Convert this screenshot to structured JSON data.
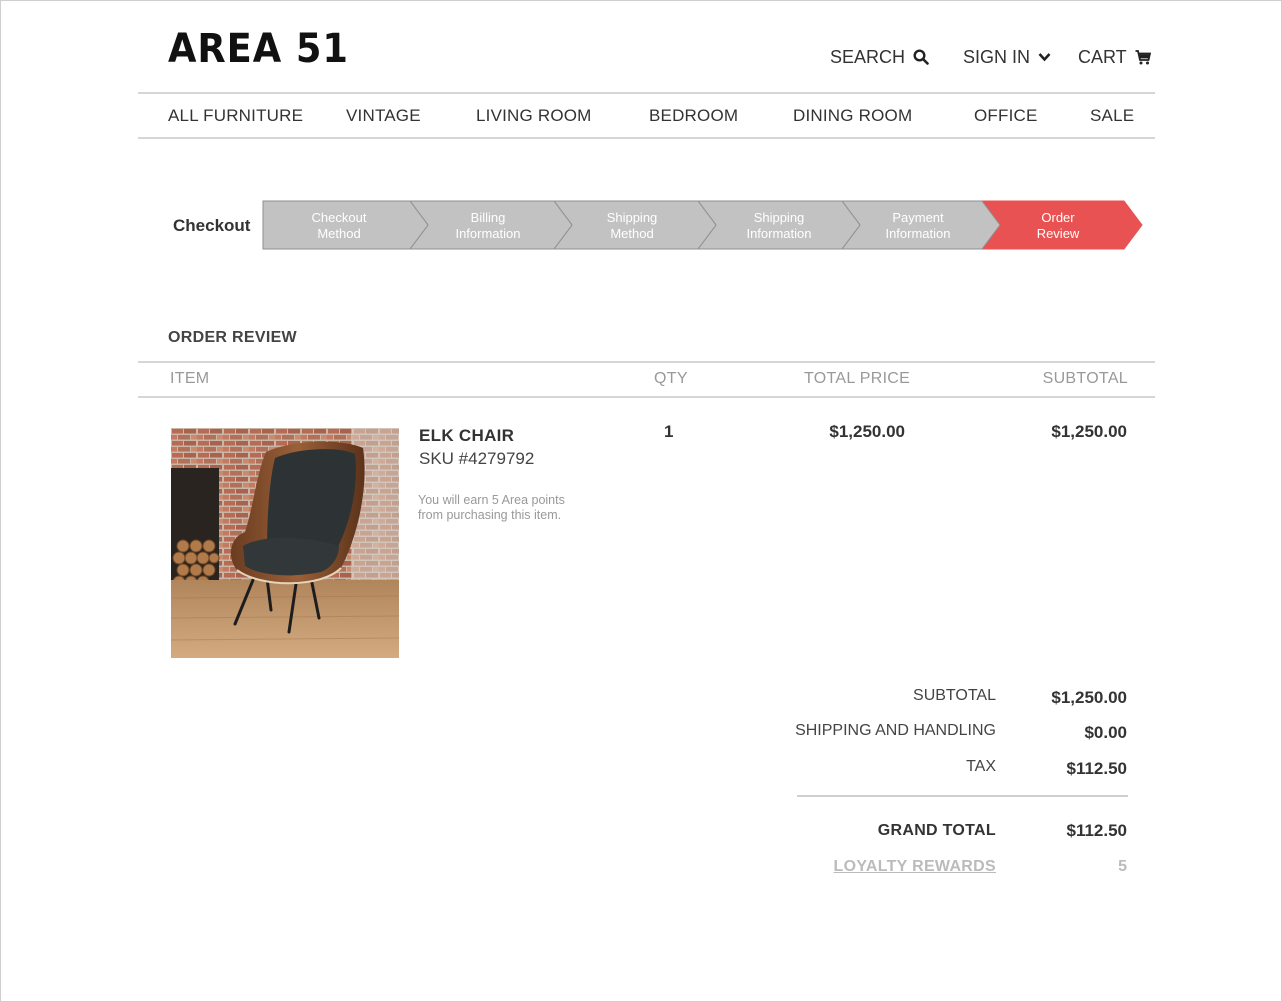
{
  "brand": {
    "logo": "AREA 51"
  },
  "header": {
    "search_label": "SEARCH",
    "signin_label": "SIGN IN",
    "cart_label": "CART"
  },
  "categories": [
    "ALL FURNITURE",
    "VINTAGE",
    "LIVING ROOM",
    "BEDROOM",
    "DINING ROOM",
    "OFFICE",
    "SALE"
  ],
  "checkout": {
    "label": "Checkout",
    "steps": [
      {
        "line1": "Checkout",
        "line2": "Method",
        "state": "complete"
      },
      {
        "line1": "Billing",
        "line2": "Information",
        "state": "complete"
      },
      {
        "line1": "Shipping",
        "line2": "Method",
        "state": "complete"
      },
      {
        "line1": "Shipping",
        "line2": "Information",
        "state": "complete"
      },
      {
        "line1": "Payment",
        "line2": "Information",
        "state": "complete"
      },
      {
        "line1": "Order",
        "line2": "Review",
        "state": "active"
      }
    ],
    "colors": {
      "complete": "#c2c2c2",
      "active": "#e85252",
      "border": "#8f8f8f"
    }
  },
  "order_review": {
    "title": "ORDER REVIEW",
    "columns": {
      "item": "ITEM",
      "qty": "QTY",
      "total_price": "TOTAL PRICE",
      "subtotal": "SUBTOTAL"
    },
    "items": [
      {
        "name": "ELK CHAIR",
        "sku": "SKU #4279792",
        "note": "You will earn 5 Area points from purchasing this item.",
        "qty": "1",
        "total_price": "$1,250.00",
        "subtotal": "$1,250.00"
      }
    ]
  },
  "totals": {
    "subtotal_label": "SUBTOTAL",
    "subtotal": "$1,250.00",
    "shipping_label": "SHIPPING AND HANDLING",
    "shipping": "$0.00",
    "tax_label": "TAX",
    "tax": "$112.50",
    "grand_total_label": "GRAND TOTAL",
    "grand_total": "$112.50",
    "loyalty_label": "LOYALTY REWARDS",
    "loyalty": "5"
  }
}
